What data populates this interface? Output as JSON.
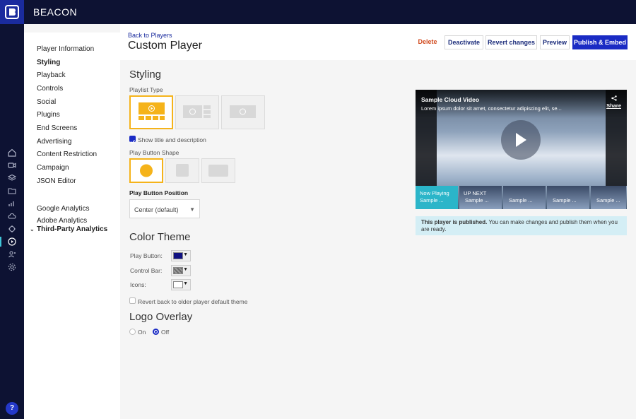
{
  "brand": {
    "name": "BEACON"
  },
  "rail": {
    "icons": [
      "home-icon",
      "video-icon",
      "layers-icon",
      "folder-icon",
      "analytics-icon",
      "cloud-icon",
      "integrations-icon",
      "player-icon",
      "users-icon",
      "settings-icon"
    ],
    "help_label": "?"
  },
  "nav": {
    "items": [
      {
        "label": "Player Information",
        "active": false
      },
      {
        "label": "Styling",
        "active": true
      },
      {
        "label": "Playback",
        "active": false
      },
      {
        "label": "Controls",
        "active": false
      },
      {
        "label": "Social",
        "active": false
      },
      {
        "label": "Plugins",
        "active": false
      },
      {
        "label": "End Screens",
        "active": false
      },
      {
        "label": "Advertising",
        "active": false
      },
      {
        "label": "Content Restriction",
        "active": false
      },
      {
        "label": "Campaign",
        "active": false
      },
      {
        "label": "JSON Editor",
        "active": false
      }
    ],
    "section": {
      "label": "Third-Party Analytics",
      "items": [
        {
          "label": "Google Analytics"
        },
        {
          "label": "Adobe Analytics"
        }
      ]
    }
  },
  "header": {
    "back_label": "Back to Players",
    "title": "Custom Player",
    "delete_label": "Delete",
    "deactivate_label": "Deactivate",
    "revert_label": "Revert changes",
    "preview_label": "Preview",
    "publish_label": "Publish & Embed"
  },
  "styling": {
    "heading": "Styling",
    "playlist_type_label": "Playlist Type",
    "playlist_selected_index": 0,
    "show_title_label": "Show title and description",
    "show_title_checked": true,
    "play_button_shape_label": "Play Button Shape",
    "play_button_shape_selected_index": 0,
    "play_button_position_label": "Play Button Position",
    "play_button_position_value": "Center (default)"
  },
  "color_theme": {
    "heading": "Color Theme",
    "play_button_label": "Play Button:",
    "control_bar_label": "Control Bar:",
    "icons_label": "Icons:",
    "play_button_color": "#0f1080",
    "control_bar_color": "#7a7a7a",
    "icons_color": "#ffffff",
    "revert_label": "Revert back to older player default theme",
    "revert_checked": false
  },
  "logo_overlay": {
    "heading": "Logo Overlay",
    "on_label": "On",
    "off_label": "Off",
    "selected": "Off"
  },
  "preview": {
    "video_title": "Sample Cloud Video",
    "video_desc": "Lorem ipsum dolor sit amet, consectetur adipiscing elit, se...",
    "share_label": "Share",
    "thumbs": [
      {
        "line1": "Now Playing",
        "line2": "Sample ..."
      },
      {
        "line1": "UP NEXT",
        "line2": "Sample ..."
      },
      {
        "line1": "",
        "line2": "Sample ..."
      },
      {
        "line1": "",
        "line2": "Sample ..."
      },
      {
        "line1": "",
        "line2": "Sample ..."
      }
    ],
    "notice_bold": "This player is published.",
    "notice_text": " You can make changes and publish them when you are ready."
  },
  "colors": {
    "accent": "#1a2bc4",
    "selection": "#f5b31a",
    "delete": "#d14b1f",
    "nav_bg": "#0d1233",
    "teal": "#2bb5c9"
  }
}
